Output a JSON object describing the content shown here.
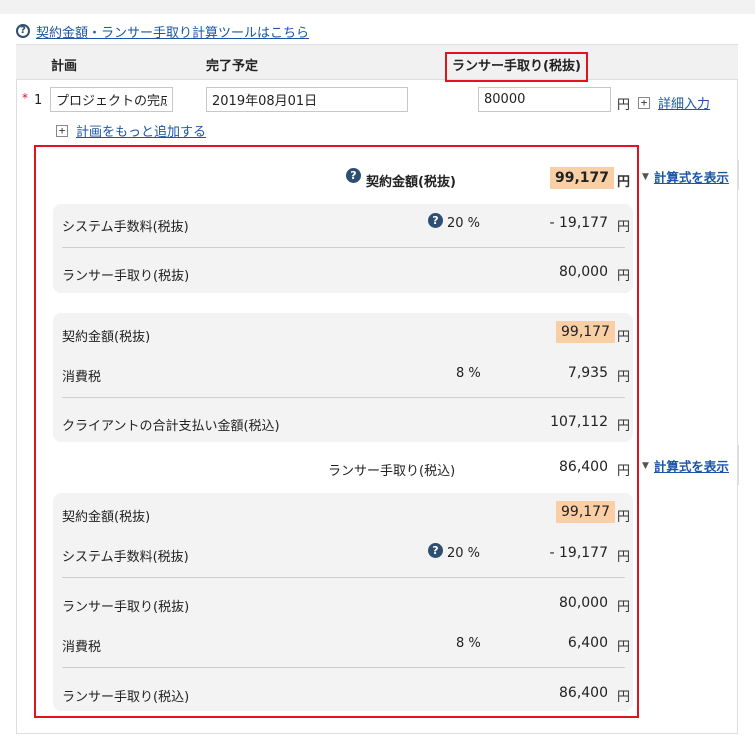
{
  "top_link": {
    "label": "契約金額・ランサー手取り計算ツールはこちら"
  },
  "table_header": {
    "plan": "計画",
    "due": "完了予定",
    "payout": "ランサー手取り(税抜)"
  },
  "row": {
    "required_mark": "*",
    "number": "1",
    "plan_value": "プロジェクトの完成",
    "date_value": "2019年08月01日",
    "amount_value": "80000",
    "yen": "円",
    "detail_label": "詳細入力"
  },
  "add_plan_label": "計画をもっと追加する",
  "summary": {
    "contract_label": "契約金額(税抜)",
    "contract_value": "99,177",
    "yen": "円",
    "show_formula_label": "計算式を表示"
  },
  "breakdown1": {
    "fee_label": "システム手数料(税抜)",
    "fee_percent": "20 %",
    "fee_value": "-  19,177",
    "payout_label": "ランサー手取り(税抜)",
    "payout_value": "80,000"
  },
  "breakdown2": {
    "contract_label": "契約金額(税抜)",
    "contract_value": "99,177",
    "tax_label": "消費税",
    "tax_percent": "8 %",
    "tax_value": "7,935",
    "client_total_label": "クライアントの合計支払い金額(税込)",
    "client_total_value": "107,112"
  },
  "payout_incl": {
    "label": "ランサー手取り(税込)",
    "value": "86,400",
    "show_formula_label": "計算式を表示"
  },
  "breakdown3": {
    "contract_label": "契約金額(税抜)",
    "contract_value": "99,177",
    "fee_label": "システム手数料(税抜)",
    "fee_percent": "20 %",
    "fee_value": "-  19,177",
    "payout_label": "ランサー手取り(税抜)",
    "payout_value": "80,000",
    "tax_label": "消費税",
    "tax_percent": "8 %",
    "tax_value": "6,400",
    "payout_incl_label": "ランサー手取り(税込)",
    "payout_incl_value": "86,400"
  },
  "colors": {
    "highlight": "#fbcfa6",
    "annotation_red": "#e0141e",
    "link": "#1a55a6"
  },
  "icons": {
    "help": "question-circle-icon",
    "plus": "plus-square-icon",
    "toggle": "triangle-down-icon"
  }
}
